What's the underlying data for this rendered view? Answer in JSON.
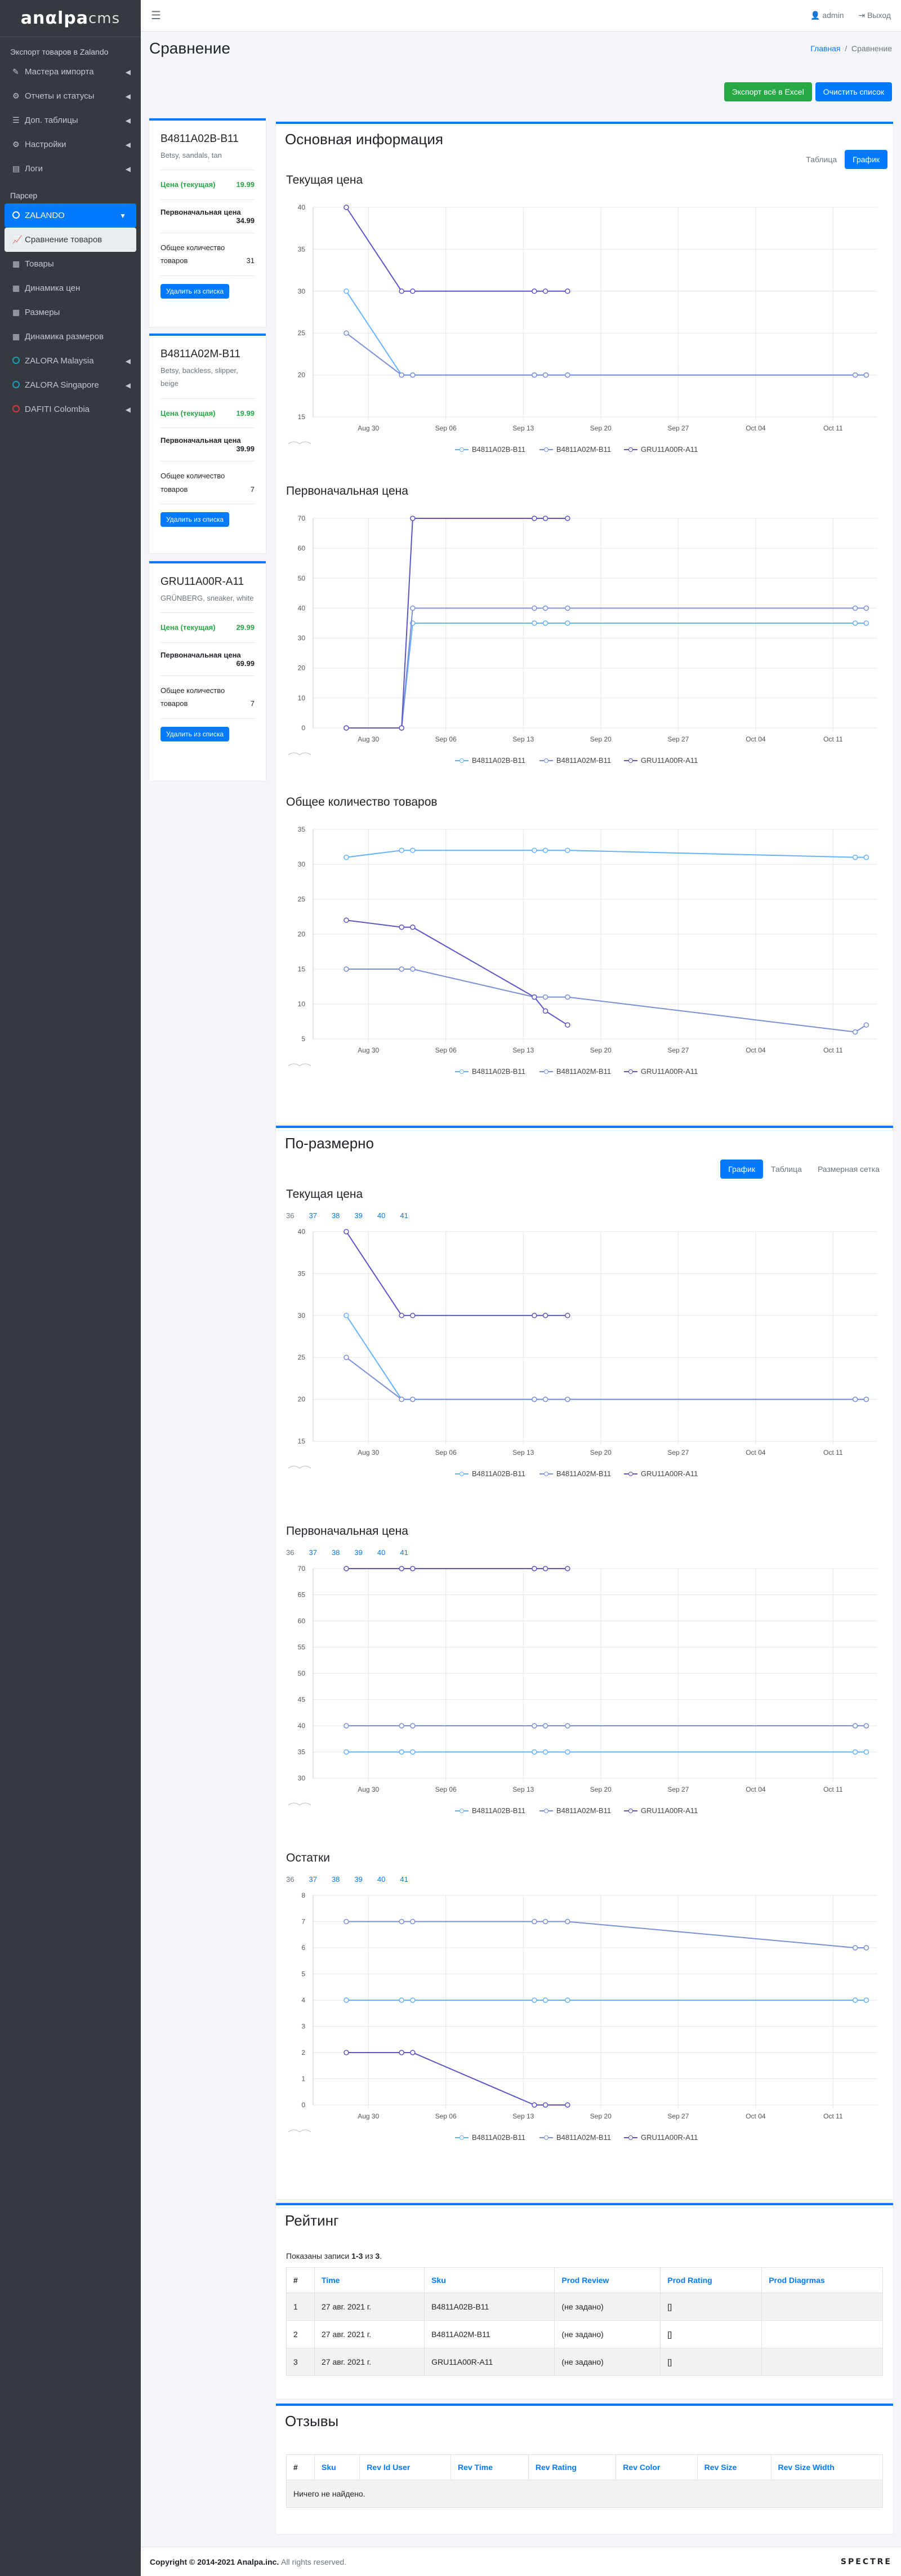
{
  "brand": {
    "name": "anαlpa",
    "suffix": "cms"
  },
  "topbar": {
    "user": "admin",
    "logout": "Выход"
  },
  "sidebar": {
    "section1": "Экспорт товаров в Zalando",
    "items": [
      {
        "label": "Мастера импорта",
        "icon": "wand-icon"
      },
      {
        "label": "Отчеты и статусы",
        "icon": "gear-icon"
      },
      {
        "label": "Доп. таблицы",
        "icon": "list-icon"
      },
      {
        "label": "Настройки",
        "icon": "cog-icon"
      },
      {
        "label": "Логи",
        "icon": "file-icon"
      }
    ],
    "section2": "Парсер",
    "parser": [
      {
        "label": "ZALANDO",
        "state": "active"
      },
      {
        "label": "Сравнение товаров",
        "state": "sub-active"
      },
      {
        "label": "Товары"
      },
      {
        "label": "Динамика цен"
      },
      {
        "label": "Размеры"
      },
      {
        "label": "Динамика размеров"
      },
      {
        "label": "ZALORA Malaysia"
      },
      {
        "label": "ZALORA Singapore"
      },
      {
        "label": "DAFITI Colombia"
      }
    ]
  },
  "page": {
    "title": "Сравнение",
    "crumb_home": "Главная",
    "crumb_sep": "/",
    "crumb_current": "Сравнение"
  },
  "actions": {
    "export": "Экспорт всё в Excel",
    "clear": "Очистить список"
  },
  "products": [
    {
      "sku": "B4811A02B-B11",
      "desc": "Betsy, sandals, tan",
      "price_label": "Цена (текущая)",
      "price": "19.99",
      "orig_label": "Первоначальная цена",
      "orig": "34.99",
      "qty_label": "Общее количество товаров",
      "qty": "31",
      "remove": "Удалить из списка"
    },
    {
      "sku": "B4811A02M-B11",
      "desc": "Betsy, backless, slipper, beige",
      "price_label": "Цена (текущая)",
      "price": "19.99",
      "orig_label": "Первоначальная цена",
      "orig": "39.99",
      "qty_label": "Общее количество товаров",
      "qty": "7",
      "remove": "Удалить из списка"
    },
    {
      "sku": "GRU11A00R-A11",
      "desc": "GRÜNBERG, sneaker, white",
      "price_label": "Цена (текущая)",
      "price": "29.99",
      "orig_label": "Первоначальная цена",
      "orig": "69.99",
      "qty_label": "Общее количество товаров",
      "qty": "7",
      "remove": "Удалить из списка"
    }
  ],
  "main": {
    "title": "Основная информация",
    "tab_table": "Таблица",
    "tab_chart": "График"
  },
  "size_section": {
    "title": "По-размерно",
    "tab_chart": "График",
    "tab_table": "Таблица",
    "tab_grid": "Размерная сетка",
    "sizes": [
      "36",
      "37",
      "38",
      "39",
      "40",
      "41"
    ]
  },
  "chart_data": [
    {
      "type": "line",
      "title": "Текущая цена",
      "x": [
        "Aug 28",
        "Sep 02",
        "Sep 03",
        "Sep 14",
        "Sep 15",
        "Sep 17",
        "Oct 13",
        "Oct 14"
      ],
      "xticks": [
        "Aug 30",
        "Sep 06",
        "Sep 13",
        "Sep 20",
        "Sep 27",
        "Oct 04",
        "Oct 11"
      ],
      "ylim": [
        15,
        40
      ],
      "yticks": [
        15,
        20,
        25,
        30,
        35,
        40
      ],
      "series": [
        {
          "name": "B4811A02B-B11",
          "color": "#66b2ff",
          "values": [
            30,
            20,
            20,
            20,
            20,
            20,
            20,
            20
          ]
        },
        {
          "name": "B4811A02M-B11",
          "color": "#7a8fd6",
          "values": [
            25,
            20,
            20,
            20,
            20,
            20,
            20,
            20
          ]
        },
        {
          "name": "GRU11A00R-A11",
          "color": "#5a55c2",
          "values": [
            40,
            30,
            30,
            30,
            30,
            30,
            null,
            null
          ]
        }
      ]
    },
    {
      "type": "line",
      "title": "Первоначальная цена",
      "x": [
        "Aug 28",
        "Sep 02",
        "Sep 03",
        "Sep 14",
        "Sep 15",
        "Sep 17",
        "Oct 13",
        "Oct 14"
      ],
      "xticks": [
        "Aug 30",
        "Sep 06",
        "Sep 13",
        "Sep 20",
        "Sep 27",
        "Oct 04",
        "Oct 11"
      ],
      "ylim": [
        0,
        70
      ],
      "yticks": [
        0,
        10,
        20,
        30,
        40,
        50,
        60,
        70
      ],
      "series": [
        {
          "name": "B4811A02B-B11",
          "color": "#66b2ff",
          "values": [
            0,
            0,
            35,
            35,
            35,
            35,
            35,
            35
          ]
        },
        {
          "name": "B4811A02M-B11",
          "color": "#7a8fd6",
          "values": [
            0,
            0,
            40,
            40,
            40,
            40,
            40,
            40
          ]
        },
        {
          "name": "GRU11A00R-A11",
          "color": "#5a55c2",
          "values": [
            0,
            0,
            70,
            70,
            70,
            70,
            null,
            null
          ]
        }
      ]
    },
    {
      "type": "line",
      "title": "Общее количество товаров",
      "x": [
        "Aug 28",
        "Sep 02",
        "Sep 03",
        "Sep 14",
        "Sep 15",
        "Sep 17",
        "Oct 13",
        "Oct 14"
      ],
      "xticks": [
        "Aug 30",
        "Sep 06",
        "Sep 13",
        "Sep 20",
        "Sep 27",
        "Oct 04",
        "Oct 11"
      ],
      "ylim": [
        5,
        35
      ],
      "yticks": [
        5,
        10,
        15,
        20,
        25,
        30,
        35
      ],
      "series": [
        {
          "name": "B4811A02B-B11",
          "color": "#66b2ff",
          "values": [
            31,
            32,
            32,
            32,
            32,
            32,
            31,
            31
          ]
        },
        {
          "name": "B4811A02M-B11",
          "color": "#7a8fd6",
          "values": [
            15,
            15,
            15,
            11,
            11,
            11,
            6,
            7
          ]
        },
        {
          "name": "GRU11A00R-A11",
          "color": "#5a55c2",
          "values": [
            22,
            21,
            21,
            11,
            9,
            7,
            null,
            null
          ]
        }
      ]
    },
    {
      "type": "line",
      "title": "Текущая цена",
      "x": [
        "Aug 28",
        "Sep 02",
        "Sep 03",
        "Sep 14",
        "Sep 15",
        "Sep 17",
        "Oct 13",
        "Oct 14"
      ],
      "xticks": [
        "Aug 30",
        "Sep 06",
        "Sep 13",
        "Sep 20",
        "Sep 27",
        "Oct 04",
        "Oct 11"
      ],
      "ylim": [
        15,
        40
      ],
      "yticks": [
        15,
        20,
        25,
        30,
        35,
        40
      ],
      "series": [
        {
          "name": "B4811A02B-B11",
          "color": "#66b2ff",
          "values": [
            30,
            20,
            20,
            20,
            20,
            20,
            20,
            20
          ]
        },
        {
          "name": "B4811A02M-B11",
          "color": "#7a8fd6",
          "values": [
            25,
            20,
            20,
            20,
            20,
            20,
            20,
            20
          ]
        },
        {
          "name": "GRU11A00R-A11",
          "color": "#5a55c2",
          "values": [
            40,
            30,
            30,
            30,
            30,
            30,
            null,
            null
          ]
        }
      ]
    },
    {
      "type": "line",
      "title": "Первоначальная цена",
      "x": [
        "Aug 28",
        "Sep 02",
        "Sep 03",
        "Sep 14",
        "Sep 15",
        "Sep 17",
        "Oct 13",
        "Oct 14"
      ],
      "xticks": [
        "Aug 30",
        "Sep 06",
        "Sep 13",
        "Sep 20",
        "Sep 27",
        "Oct 04",
        "Oct 11"
      ],
      "ylim": [
        30,
        70
      ],
      "yticks": [
        30,
        35,
        40,
        45,
        50,
        55,
        60,
        65,
        70
      ],
      "series": [
        {
          "name": "B4811A02B-B11",
          "color": "#66b2ff",
          "values": [
            35,
            35,
            35,
            35,
            35,
            35,
            35,
            35
          ]
        },
        {
          "name": "B4811A02M-B11",
          "color": "#7a8fd6",
          "values": [
            40,
            40,
            40,
            40,
            40,
            40,
            40,
            40
          ]
        },
        {
          "name": "GRU11A00R-A11",
          "color": "#5a55c2",
          "values": [
            70,
            70,
            70,
            70,
            70,
            70,
            null,
            null
          ]
        }
      ]
    },
    {
      "type": "line",
      "title": "Остатки",
      "x": [
        "Aug 28",
        "Sep 02",
        "Sep 03",
        "Sep 14",
        "Sep 15",
        "Sep 17",
        "Oct 13",
        "Oct 14"
      ],
      "xticks": [
        "Aug 30",
        "Sep 06",
        "Sep 13",
        "Sep 20",
        "Sep 27",
        "Oct 04",
        "Oct 11"
      ],
      "ylim": [
        0,
        8
      ],
      "yticks": [
        0,
        1,
        2,
        3,
        4,
        5,
        6,
        7,
        8
      ],
      "series": [
        {
          "name": "B4811A02B-B11",
          "color": "#66b2ff",
          "values": [
            4,
            4,
            4,
            4,
            4,
            4,
            4,
            4
          ]
        },
        {
          "name": "B4811A02M-B11",
          "color": "#7a8fd6",
          "values": [
            7,
            7,
            7,
            7,
            7,
            7,
            6,
            6
          ]
        },
        {
          "name": "GRU11A00R-A11",
          "color": "#5a55c2",
          "values": [
            2,
            2,
            2,
            0,
            0,
            0,
            null,
            null
          ]
        }
      ]
    }
  ],
  "rating": {
    "title": "Рейтинг",
    "summary_pre": "Показаны записи",
    "summary_range": "1-3",
    "summary_mid": "из",
    "summary_total": "3",
    "headers": [
      "#",
      "Time",
      "Sku",
      "Prod Review",
      "Prod Rating",
      "Prod Diagrmas"
    ],
    "rows": [
      [
        "1",
        "27 авг. 2021 г.",
        "B4811A02B-B11",
        "(не задано)",
        "[]",
        ""
      ],
      [
        "2",
        "27 авг. 2021 г.",
        "B4811A02M-B11",
        "(не задано)",
        "[]",
        ""
      ],
      [
        "3",
        "27 авг. 2021 г.",
        "GRU11A00R-A11",
        "(не задано)",
        "[]",
        ""
      ]
    ]
  },
  "reviews": {
    "title": "Отзывы",
    "headers": [
      "#",
      "Sku",
      "Rev Id User",
      "Rev Time",
      "Rev Rating",
      "Rev Color",
      "Rev Size",
      "Rev Size Width"
    ],
    "empty": "Ничего не найдено."
  },
  "footer": {
    "copyright": "Copyright © 2014-2021 Analpa.inc.",
    "rights": "All rights reserved.",
    "logo": "SPECTRE"
  }
}
